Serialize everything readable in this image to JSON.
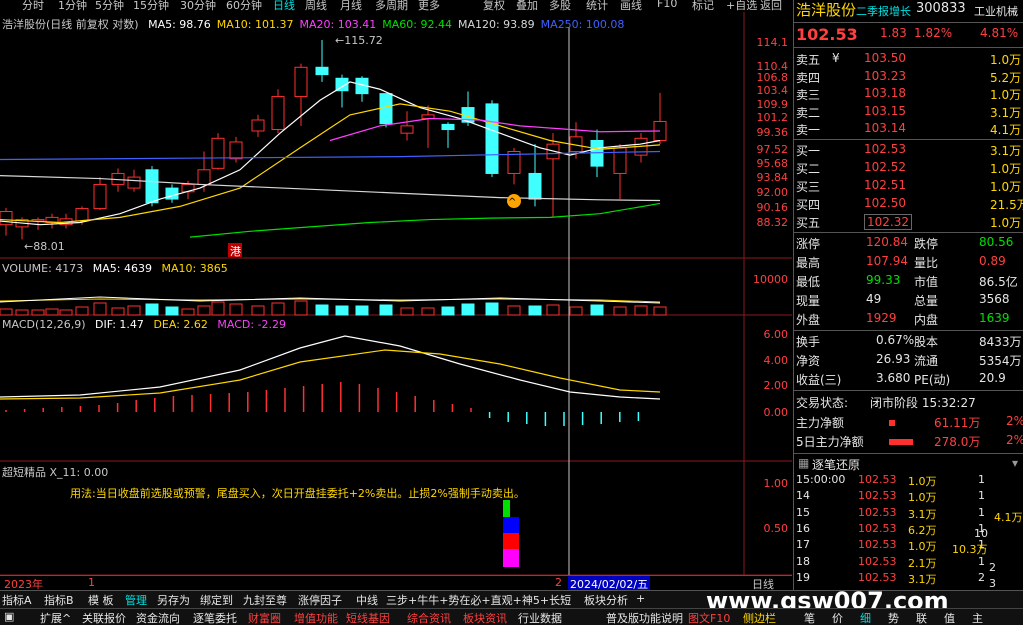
{
  "topbar": {
    "items": [
      "分时",
      "1分钟",
      "5分钟",
      "15分钟",
      "30分钟",
      "60分钟",
      "日线",
      "周线",
      "月线",
      "多周期",
      "更多"
    ],
    "active": "日线",
    "right_items": [
      "复权",
      "叠加",
      "多股",
      "统计",
      "画线",
      "F10",
      "标记",
      "+自选",
      "返回"
    ]
  },
  "main_panel": {
    "title": "浩洋股份(日线 前复权 对数)",
    "ma": [
      {
        "label": "MA5: 98.76",
        "color": "#ffffff"
      },
      {
        "label": "MA10: 101.37",
        "color": "#ffd700"
      },
      {
        "label": "MA20: 103.41",
        "color": "#ff40ff"
      },
      {
        "label": "MA60: 92.44",
        "color": "#00e000"
      },
      {
        "label": "MA120: 93.89",
        "color": "#d8d8d8"
      },
      {
        "label": "MA250: 100.08",
        "color": "#4060ff"
      }
    ],
    "high_mark": "115.72",
    "low_mark": "88.01",
    "badge": "港",
    "ticks": [
      "114.1",
      "110.4",
      "106.8",
      "103.4",
      "109.9",
      "101.2",
      "99.36",
      "97.52",
      "95.68",
      "93.84",
      "92.00",
      "90.16",
      "88.32"
    ]
  },
  "volume_panel": {
    "title": "VOLUME: 4173",
    "ma5": "MA5: 4639",
    "ma10": "MA10: 3865",
    "tick": "10000"
  },
  "macd_panel": {
    "title": "MACD(12,26,9)",
    "dif": "DIF: 1.47",
    "dea": "DEA: 2.62",
    "macd": "MACD: -2.29",
    "ticks": [
      "6.00",
      "4.00",
      "2.00",
      "0.00"
    ]
  },
  "short_panel": {
    "title": "超短精品 X_11: 0.00",
    "note": "用法:当日收盘前选股或预警，尾盘买入，次日开盘挂委托+2%卖出。止损2%强制手动卖出。",
    "ticks": [
      "1.00",
      "0.50"
    ]
  },
  "date_bar": {
    "year": "2023年",
    "left_num": "1",
    "right_num": "2",
    "cursor_date": "2024/02/02/五",
    "period": "日线"
  },
  "stock": {
    "name": "浩洋股份",
    "board": "二季报增长",
    "code": "300833",
    "industry": "工业机械",
    "price": "102.53",
    "change": "1.83",
    "pct": "1.82%",
    "amp": "4.81%"
  },
  "asks": [
    {
      "label": "卖五",
      "sym": "¥",
      "price": "103.50",
      "vol": "1.0万"
    },
    {
      "label": "卖四",
      "sym": "",
      "price": "103.23",
      "vol": "5.2万"
    },
    {
      "label": "卖三",
      "sym": "",
      "price": "103.18",
      "vol": "1.0万"
    },
    {
      "label": "卖二",
      "sym": "",
      "price": "103.15",
      "vol": "3.1万"
    },
    {
      "label": "卖一",
      "sym": "",
      "price": "103.14",
      "vol": "4.1万"
    }
  ],
  "bids": [
    {
      "label": "买一",
      "price": "102.53",
      "vol": "3.1万"
    },
    {
      "label": "买二",
      "price": "102.52",
      "vol": "1.0万"
    },
    {
      "label": "买三",
      "price": "102.51",
      "vol": "1.0万"
    },
    {
      "label": "买四",
      "price": "102.50",
      "vol": "21.5万"
    },
    {
      "label": "买五",
      "price": "102.32",
      "vol": "1.0万"
    }
  ],
  "quote": [
    {
      "l1": "涨停",
      "v1": "120.84",
      "c1": "red",
      "l2": "跌停",
      "v2": "80.56",
      "c2": "grn"
    },
    {
      "l1": "最高",
      "v1": "107.94",
      "c1": "red",
      "l2": "量比",
      "v2": "0.89",
      "c2": "red"
    },
    {
      "l1": "最低",
      "v1": "99.33",
      "c1": "grn",
      "l2": "市值",
      "v2": "86.5亿",
      "c2": "wht"
    },
    {
      "l1": "现量",
      "v1": "49",
      "c1": "wht",
      "l2": "总量",
      "v2": "3568",
      "c2": "wht"
    },
    {
      "l1": "外盘",
      "v1": "1929",
      "c1": "red",
      "l2": "内盘",
      "v2": "1639",
      "c2": "grn"
    }
  ],
  "quote2": [
    {
      "l1": "换手",
      "v1": "0.67%",
      "l2": "股本",
      "v2": "8433万"
    },
    {
      "l1": "净资",
      "v1": "26.93",
      "l2": "流通",
      "v2": "5354万"
    },
    {
      "l1": "收益(三)",
      "v1": "3.680",
      "l2": "PE(动)",
      "v2": "20.9"
    }
  ],
  "status": {
    "label": "交易状态:",
    "value": "闭市阶段 15:32:27"
  },
  "flows": [
    {
      "label": "主力净额",
      "value": "61.11万",
      "pct": "2%"
    },
    {
      "label": "5日主力净额",
      "value": "278.0万",
      "pct": "2%"
    }
  ],
  "ticks_panel": {
    "title": "逐笔还原",
    "rows": [
      {
        "t": "15:00:00",
        "p": "102.53",
        "v": "1.0万",
        "n": "1"
      },
      {
        "t": "14",
        "p": "102.53",
        "v": "1.0万",
        "n": "1"
      },
      {
        "t": "15",
        "p": "102.53",
        "v": "3.1万",
        "n": "1"
      },
      {
        "t": "16",
        "p": "102.53",
        "v": "6.2万",
        "n": "1"
      },
      {
        "t": "17",
        "p": "102.53",
        "v": "1.0万",
        "n": "1"
      },
      {
        "t": "18",
        "p": "102.53",
        "v": "2.1万",
        "n": "1"
      },
      {
        "t": "19",
        "p": "102.53",
        "v": "3.1万",
        "n": "2"
      }
    ],
    "side": [
      "4.1万",
      "10",
      "10.3万",
      "2",
      "3"
    ]
  },
  "bottom1": [
    "指标A",
    "指标B",
    "模 板",
    "管理",
    "另存为",
    "绑定到",
    "九封至尊",
    "涨停因子",
    "中线",
    "三步+牛牛+势在必+直观+神5+长短",
    "板块分析",
    "+"
  ],
  "bottom2": [
    "扩展^",
    "关联报价",
    "资金流向",
    "逐笔委托",
    "财富圈",
    "增值功能",
    "短线基因",
    "综合资讯",
    "板块资讯",
    "行业数据",
    "普及版功能说明",
    "图文F10",
    "侧边栏"
  ],
  "bottom2_right": [
    "笔",
    "价",
    "细",
    "势",
    "联",
    "值",
    "主"
  ],
  "watermark": "www.gsw007.com"
}
